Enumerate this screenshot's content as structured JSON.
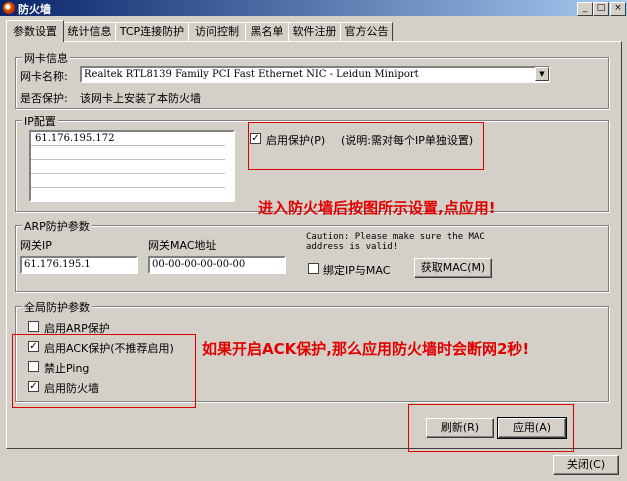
{
  "window": {
    "title": "防火墙",
    "minimize": "_",
    "restore": "□",
    "close": "×"
  },
  "tabs": [
    "参数设置",
    "统计信息",
    "TCP连接防护",
    "访问控制",
    "黑名单",
    "软件注册",
    "官方公告"
  ],
  "nic_group": {
    "label": "网卡信息",
    "name_label": "网卡名称:",
    "name_value": "Realtek RTL8139 Family PCI Fast Ethernet NIC - Leidun Miniport",
    "protect_label": "是否保护:",
    "protect_value": "该网卡上安装了本防火墙"
  },
  "ip_group": {
    "label": "IP配置",
    "ips": [
      "61.176.195.172"
    ],
    "enable_protect_label": "启用保护(P)",
    "enable_protect_note": "(说明:需对每个IP单独设置)",
    "enable_protect_checked": true
  },
  "annotation_top": "进入防火墙后按图所示设置,点应用!",
  "arp_group": {
    "label": "ARP防护参数",
    "gateway_ip_label": "网关IP",
    "gateway_ip_value": "61.176.195.1",
    "gateway_mac_label": "网关MAC地址",
    "gateway_mac_value": "00-00-00-00-00-00",
    "caution": "Caution: Please make sure the MAC address is valid!",
    "bind_label": "绑定IP与MAC",
    "bind_checked": false,
    "get_mac_button": "获取MAC(M)"
  },
  "global_group": {
    "label": "全局防护参数",
    "options": [
      {
        "label": "启用ARP保护",
        "checked": false
      },
      {
        "label": "启用ACK保护(不推荐启用)",
        "checked": true
      },
      {
        "label": "禁止Ping",
        "checked": false
      },
      {
        "label": "启用防火墙",
        "checked": true
      }
    ]
  },
  "annotation_bottom": "如果开启ACK保护,那么应用防火墙时会断网2秒!",
  "buttons": {
    "refresh": "刷新(R)",
    "apply": "应用(A)",
    "close": "关闭(C)"
  },
  "colors": {
    "annotation": "#e00000",
    "titlebar_start": "#0a246a",
    "titlebar_end": "#a6caf0",
    "face": "#d4d0c8"
  }
}
